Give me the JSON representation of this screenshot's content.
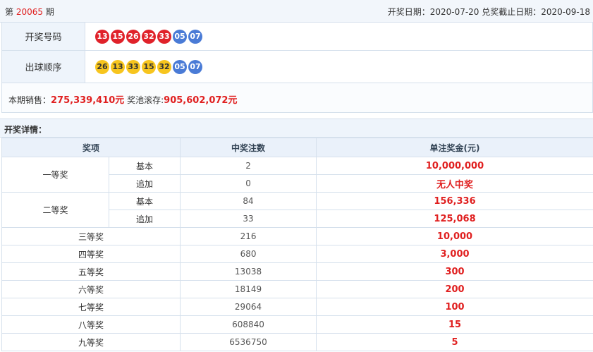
{
  "header": {
    "issue_prefix": "第 ",
    "issue_number": "20065",
    "issue_suffix": " 期",
    "dates": "开奖日期：2020-07-20 兑奖截止日期：2020-09-18"
  },
  "draw_numbers": {
    "label": "开奖号码",
    "front": [
      "13",
      "15",
      "26",
      "32",
      "33"
    ],
    "back": [
      "05",
      "07"
    ]
  },
  "draw_order": {
    "label": "出球顺序",
    "front": [
      "26",
      "13",
      "33",
      "15",
      "32"
    ],
    "back": [
      "05",
      "07"
    ]
  },
  "sales": {
    "sales_label": "本期销售：",
    "sales_amount": "275,339,410元",
    "pool_label": " 奖池滚存:",
    "pool_amount": "905,602,072元"
  },
  "details": {
    "title": "开奖详情：",
    "columns": [
      "奖项",
      "中奖注数",
      "单注奖金(元)"
    ],
    "first": {
      "name": "一等奖",
      "basic": {
        "label": "基本",
        "count": "2",
        "amount": "10,000,000"
      },
      "extra": {
        "label": "追加",
        "count": "0",
        "amount": "无人中奖"
      }
    },
    "second": {
      "name": "二等奖",
      "basic": {
        "label": "基本",
        "count": "84",
        "amount": "156,336"
      },
      "extra": {
        "label": "追加",
        "count": "33",
        "amount": "125,068"
      }
    },
    "rows": [
      {
        "name": "三等奖",
        "count": "216",
        "amount": "10,000"
      },
      {
        "name": "四等奖",
        "count": "680",
        "amount": "3,000"
      },
      {
        "name": "五等奖",
        "count": "13038",
        "amount": "300"
      },
      {
        "name": "六等奖",
        "count": "18149",
        "amount": "200"
      },
      {
        "name": "七等奖",
        "count": "29064",
        "amount": "100"
      },
      {
        "name": "八等奖",
        "count": "608840",
        "amount": "15"
      },
      {
        "name": "九等奖",
        "count": "6536750",
        "amount": "5"
      }
    ]
  },
  "colors": {
    "red_ball": "#e0222a",
    "blue_ball": "#4a7bd6",
    "yellow_ball": "#f7c51e",
    "accent_red": "#e02020"
  }
}
